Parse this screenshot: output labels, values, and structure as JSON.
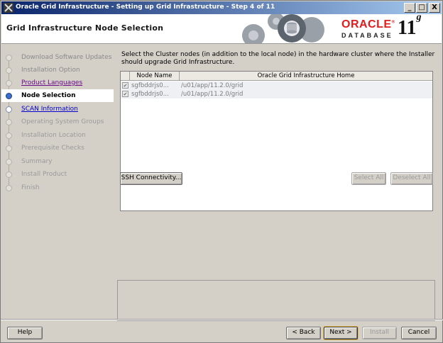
{
  "window": {
    "title": "Oracle Grid Infrastructure - Setting up Grid Infrastructure - Step 4 of 11",
    "controls": {
      "minimize": "_",
      "maximize": "□",
      "close": "X"
    }
  },
  "header": {
    "page_title": "Grid Infrastructure Node Selection",
    "brand": {
      "oracle": "ORACLE",
      "trademark": "®",
      "product": "DATABASE",
      "version": "11",
      "version_suffix": "g",
      "color": "#e01d1d"
    }
  },
  "nav": {
    "items": [
      {
        "label": "Download Software Updates",
        "state": "done"
      },
      {
        "label": "Installation Option",
        "state": "done"
      },
      {
        "label": "Product Languages",
        "state": "visited"
      },
      {
        "label": "Node Selection",
        "state": "current"
      },
      {
        "label": "SCAN Information",
        "state": "link"
      },
      {
        "label": "Operating System Groups",
        "state": "disabled"
      },
      {
        "label": "Installation Location",
        "state": "disabled"
      },
      {
        "label": "Prerequisite Checks",
        "state": "disabled"
      },
      {
        "label": "Summary",
        "state": "disabled"
      },
      {
        "label": "Install Product",
        "state": "disabled"
      },
      {
        "label": "Finish",
        "state": "disabled"
      }
    ]
  },
  "main": {
    "instructions": "Select the Cluster nodes (in addition to the local node) in the hardware cluster where the Installer should upgrade Grid Infrastructure.",
    "table": {
      "columns": [
        "Node Name",
        "Oracle Grid Infrastructure Home"
      ],
      "rows": [
        {
          "checked": true,
          "check_glyph": "✔",
          "node": "sgfbddrjs0...",
          "home": "/u01/app/11.2.0/grid"
        },
        {
          "checked": true,
          "check_glyph": "✔",
          "node": "sgfbddrjs0...",
          "home": "/u01/app/11.2.0/grid"
        }
      ]
    },
    "ssh_button": "SSH Connectivity...",
    "select_all": "Select All",
    "deselect_all": "Deselect All"
  },
  "footer": {
    "help": "Help",
    "back": "< Back",
    "next": "Next >",
    "install": "Install",
    "cancel": "Cancel"
  }
}
